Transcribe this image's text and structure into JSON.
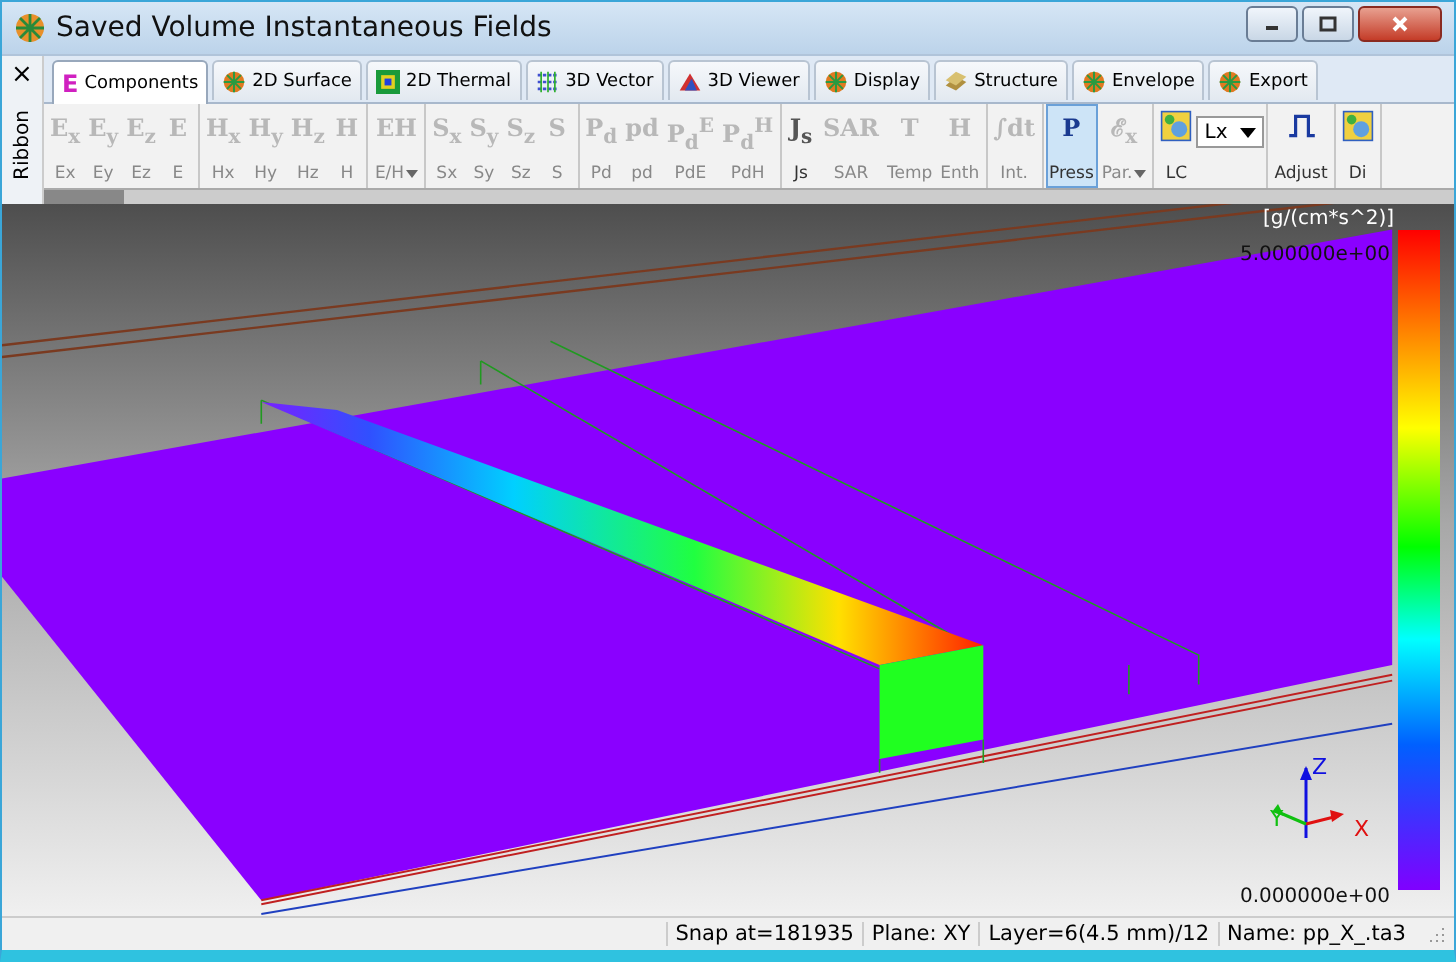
{
  "window": {
    "title": "Saved Volume Instantaneous Fields"
  },
  "ribbon": {
    "label": "Ribbon",
    "close": "×"
  },
  "tabs": [
    {
      "label": "Components",
      "selected": true,
      "glyph": "E"
    },
    {
      "label": "2D Surface",
      "selected": false
    },
    {
      "label": "2D Thermal",
      "selected": false
    },
    {
      "label": "3D Vector",
      "selected": false
    },
    {
      "label": "3D Viewer",
      "selected": false
    },
    {
      "label": "Display",
      "selected": false
    },
    {
      "label": "Structure",
      "selected": false
    },
    {
      "label": "Envelope",
      "selected": false
    },
    {
      "label": "Export",
      "selected": false
    }
  ],
  "tool_groups": [
    {
      "tools": [
        {
          "kind": "tool",
          "glyph": "E$_{x}$",
          "label": "Ex",
          "disabled": true,
          "selected": false,
          "menu": false
        },
        {
          "kind": "tool",
          "glyph": "E$_{y}$",
          "label": "Ey",
          "disabled": true,
          "selected": false,
          "menu": false
        },
        {
          "kind": "tool",
          "glyph": "E$_{z}$",
          "label": "Ez",
          "disabled": true,
          "selected": false,
          "menu": false
        },
        {
          "kind": "tool",
          "glyph": "E",
          "label": "E",
          "disabled": true,
          "selected": false,
          "menu": false
        }
      ]
    },
    {
      "tools": [
        {
          "kind": "tool",
          "glyph": "H$_{x}$",
          "label": "Hx",
          "disabled": true,
          "selected": false,
          "menu": false
        },
        {
          "kind": "tool",
          "glyph": "H$_{y}$",
          "label": "Hy",
          "disabled": true,
          "selected": false,
          "menu": false
        },
        {
          "kind": "tool",
          "glyph": "H$_{z}$",
          "label": "Hz",
          "disabled": true,
          "selected": false,
          "menu": false
        },
        {
          "kind": "tool",
          "glyph": "H",
          "label": "H",
          "disabled": true,
          "selected": false,
          "menu": false
        }
      ]
    },
    {
      "tools": [
        {
          "kind": "tool",
          "glyph": "EH",
          "label": "E/H",
          "disabled": true,
          "selected": false,
          "menu": true
        }
      ]
    },
    {
      "tools": [
        {
          "kind": "tool",
          "glyph": "S$_{x}$",
          "label": "Sx",
          "disabled": true,
          "selected": false,
          "menu": false
        },
        {
          "kind": "tool",
          "glyph": "S$_{y}$",
          "label": "Sy",
          "disabled": true,
          "selected": false,
          "menu": false
        },
        {
          "kind": "tool",
          "glyph": "S$_{z}$",
          "label": "Sz",
          "disabled": true,
          "selected": false,
          "menu": false
        },
        {
          "kind": "tool",
          "glyph": "S",
          "label": "S",
          "disabled": true,
          "selected": false,
          "menu": false
        }
      ]
    },
    {
      "tools": [
        {
          "kind": "tool",
          "glyph": "P$_{d}$",
          "label": "Pd",
          "disabled": true,
          "selected": false,
          "menu": false
        },
        {
          "kind": "tool",
          "glyph": "pd",
          "label": "pd",
          "disabled": true,
          "selected": false,
          "menu": false
        },
        {
          "kind": "tool",
          "glyph": "P$_{d}$$^{E}$",
          "label": "PdE",
          "disabled": true,
          "selected": false,
          "menu": false
        },
        {
          "kind": "tool",
          "glyph": "P$_{d}$$^{H}$",
          "label": "PdH",
          "disabled": true,
          "selected": false,
          "menu": false
        }
      ]
    },
    {
      "tools": [
        {
          "kind": "tool",
          "glyph": "J$_{s}$",
          "label": "Js",
          "disabled": false,
          "selected": false,
          "menu": false
        },
        {
          "kind": "tool",
          "glyph": "SAR",
          "label": "SAR",
          "disabled": true,
          "selected": false,
          "menu": false
        },
        {
          "kind": "tool",
          "glyph": "T",
          "label": "Temp",
          "disabled": true,
          "selected": false,
          "menu": false
        },
        {
          "kind": "tool",
          "glyph": "H",
          "label": "Enth",
          "disabled": true,
          "selected": false,
          "menu": false
        }
      ]
    },
    {
      "tools": [
        {
          "kind": "tool",
          "glyph": "∫dt",
          "label": "Int.",
          "disabled": true,
          "selected": false,
          "menu": false
        }
      ]
    },
    {
      "tools": [
        {
          "kind": "tool",
          "glyph": "P",
          "label": "Press",
          "disabled": false,
          "selected": true,
          "menu": false
        },
        {
          "kind": "tool",
          "glyph": "ℰ$_{x}$",
          "label": "Par.",
          "disabled": true,
          "selected": false,
          "menu": true
        }
      ]
    },
    {
      "tools": [
        {
          "kind": "icon",
          "label": "LC",
          "disabled": false,
          "selected": false
        },
        {
          "kind": "dropdown",
          "value": "Lx"
        }
      ]
    },
    {
      "tools": [
        {
          "kind": "pulse",
          "label": "Adjust",
          "disabled": false,
          "selected": false
        }
      ]
    },
    {
      "tools": [
        {
          "kind": "icon",
          "label": "Di",
          "disabled": false,
          "selected": false
        }
      ]
    }
  ],
  "plot": {
    "unit": "[g/(cm*s^2)]",
    "max": "5.000000e+00",
    "min": "0.000000e+00",
    "axes": {
      "x": "X",
      "y": "Y",
      "z": "Z"
    }
  },
  "status_bar": [
    "Snap at=181935",
    "Plane: XY",
    "Layer=6(4.5 mm)/12",
    "Name: pp_X_.ta3"
  ]
}
